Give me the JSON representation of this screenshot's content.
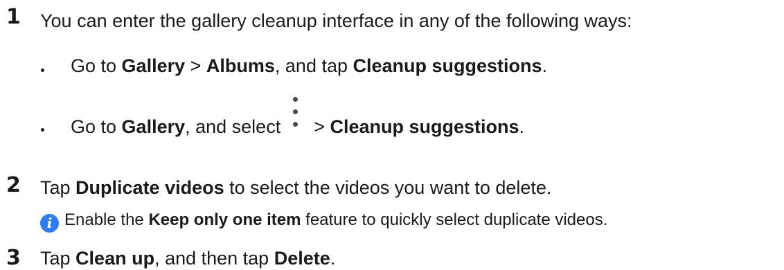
{
  "steps": [
    {
      "number": "1",
      "text": "You can enter the gallery cleanup interface in any of the following ways:",
      "bullets": [
        {
          "parts": [
            "Go to ",
            "Gallery",
            " > ",
            "Albums",
            ", and tap ",
            "Cleanup suggestions",
            "."
          ]
        },
        {
          "parts": [
            "Go to ",
            "Gallery",
            ", and select",
            "> ",
            "Cleanup suggestions",
            "."
          ],
          "icon": "more-vertical-icon"
        }
      ]
    },
    {
      "number": "2",
      "parts": [
        "Tap ",
        "Duplicate videos",
        " to select the videos you want to delete."
      ],
      "note": {
        "icon": "info-icon",
        "icon_glyph": "i",
        "icon_color": "#2e7df6",
        "parts": [
          "Enable the ",
          "Keep only one item",
          " feature to quickly select duplicate videos."
        ]
      }
    },
    {
      "number": "3",
      "parts": [
        "Tap ",
        "Clean up",
        ", and then tap ",
        "Delete",
        "."
      ]
    }
  ]
}
